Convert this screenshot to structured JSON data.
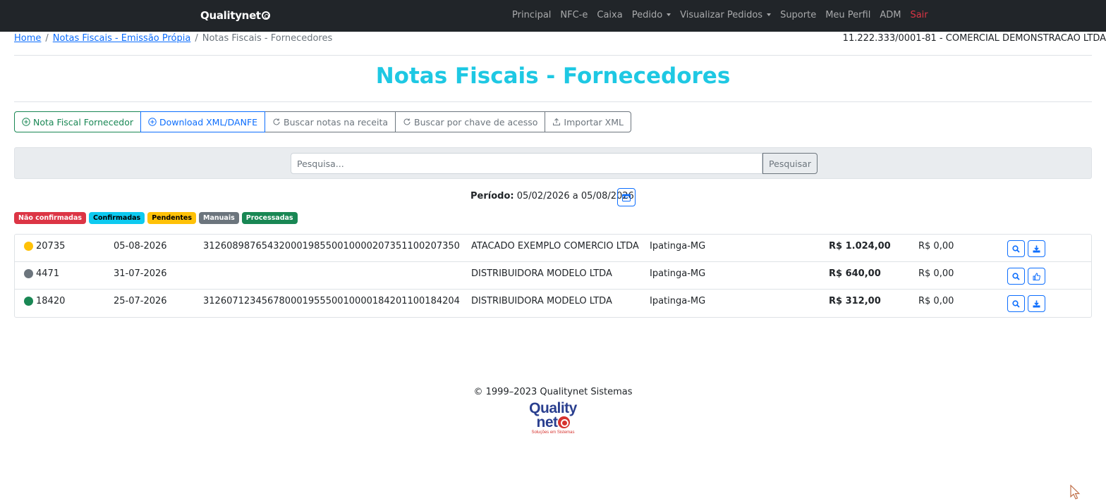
{
  "navbar": {
    "brand": "Qualitynet",
    "items": [
      "Principal",
      "NFC-e",
      "Caixa",
      "Pedido",
      "Visualizar Pedidos",
      "Suporte",
      "Meu Perfil",
      "ADM"
    ],
    "logout": "Sair"
  },
  "breadcrumb": {
    "home": "Home",
    "parent": "Notas Fiscais - Emissão Própia",
    "current": "Notas Fiscais - Fornecedores",
    "separator": "/"
  },
  "company": "11.222.333/0001-81 - COMERCIAL DEMONSTRACAO LTDA",
  "page_title": "Notas Fiscais - Fornecedores",
  "toolbar": {
    "new_invoice": "Nota Fiscal Fornecedor",
    "download": "Download XML/DANFE",
    "search_receita": "Buscar notas na receita",
    "search_key": "Buscar por chave de acesso",
    "import_xml": "Importar XML"
  },
  "search": {
    "placeholder": "Pesquisa...",
    "button": "Pesquisar"
  },
  "period": {
    "label": "Período:",
    "value": "05/02/2026 a 05/08/2026"
  },
  "status_badges": [
    {
      "label": "Não confirmadas",
      "color": "#dc3545",
      "text": "#ffffff"
    },
    {
      "label": "Confirmadas",
      "color": "#0dcaf0",
      "text": "#000000"
    },
    {
      "label": "Pendentes",
      "color": "#ffc107",
      "text": "#000000"
    },
    {
      "label": "Manuais",
      "color": "#6c757d",
      "text": "#ffffff"
    },
    {
      "label": "Processadas",
      "color": "#198754",
      "text": "#ffffff"
    }
  ],
  "invoices": [
    {
      "status_color": "#ffc107",
      "number": "20735",
      "date": "05-08-2026",
      "key": "31260898765432000198550010000207351100207350",
      "supplier": "ATACADO EXEMPLO COMERCIO LTDA",
      "city": "Ipatinga-MG",
      "total": "R$ 1.024,00",
      "other": "R$ 0,00",
      "action2": "download-icon"
    },
    {
      "status_color": "#6c757d",
      "number": "4471",
      "date": "31-07-2026",
      "key": "",
      "supplier": "DISTRIBUIDORA MODELO LTDA",
      "city": "Ipatinga-MG",
      "total": "R$ 640,00",
      "other": "R$ 0,00",
      "action2": "thumbs-up-icon"
    },
    {
      "status_color": "#198754",
      "number": "18420",
      "date": "25-07-2026",
      "key": "31260712345678000195550010000184201100184204",
      "supplier": "DISTRIBUIDORA MODELO LTDA",
      "city": "Ipatinga-MG",
      "total": "R$ 312,00",
      "other": "R$ 0,00",
      "action2": "download-icon"
    }
  ],
  "footer": {
    "copyright": "© 1999–2023 Qualitynet Sistemas",
    "logo_line1": "Quality",
    "logo_line2": "net",
    "logo_tagline": "Soluções em Sistemas"
  }
}
